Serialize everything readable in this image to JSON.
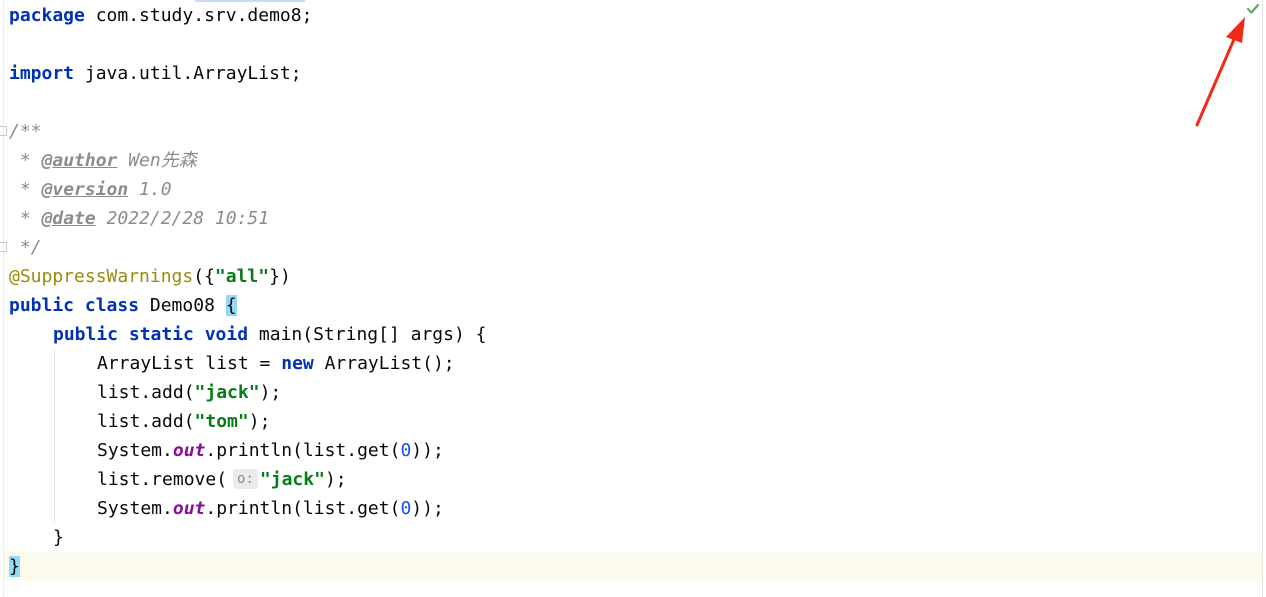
{
  "editor": {
    "lines": {
      "l1": {
        "kw": "package",
        "rest": " com.study.srv.demo8;"
      },
      "l3": {
        "kw": "import",
        "rest": " java.util.ArrayList;"
      },
      "l5": {
        "text": "/**"
      },
      "l6": {
        "prefix": " * ",
        "tag": "@author",
        "rest": " Wen先森"
      },
      "l7": {
        "prefix": " * ",
        "tag": "@version",
        "rest": " 1.0"
      },
      "l8": {
        "prefix": " * ",
        "tag": "@date",
        "rest": " 2022/2/28 10:51"
      },
      "l9": {
        "text": " */"
      },
      "l10": {
        "anno": "@SuppressWarnings",
        "open": "({",
        "str": "\"all\"",
        "close": "})"
      },
      "l11": {
        "kw": "public class",
        "name": " Demo08 ",
        "brace": "{"
      },
      "l12": {
        "kw": "public static void",
        "rest": " main(String[] args) {"
      },
      "l13": {
        "pre": "ArrayList list = ",
        "kw": "new",
        "post": " ArrayList();"
      },
      "l14": {
        "pre": "list.add(",
        "str": "\"jack\"",
        "post": ");"
      },
      "l15": {
        "pre": "list.add(",
        "str": "\"tom\"",
        "post": ");"
      },
      "l16": {
        "pre": "System.",
        "field": "out",
        "mid": ".println(list.get(",
        "num": "0",
        "post": "));"
      },
      "l17": {
        "pre": "list.remove(",
        "hint": "o:",
        "str": "\"jack\"",
        "post": ");"
      },
      "l18": {
        "pre": "System.",
        "field": "out",
        "mid": ".println(list.get(",
        "num": "0",
        "post": "));"
      },
      "l19": {
        "text": "}"
      },
      "l20": {
        "brace": "}"
      }
    }
  },
  "status": {
    "check_icon": "checkmark-icon",
    "check_color": "#59a869"
  },
  "annotation": {
    "arrow_icon": "red-arrow-icon",
    "arrow_color": "#f02a1a"
  }
}
